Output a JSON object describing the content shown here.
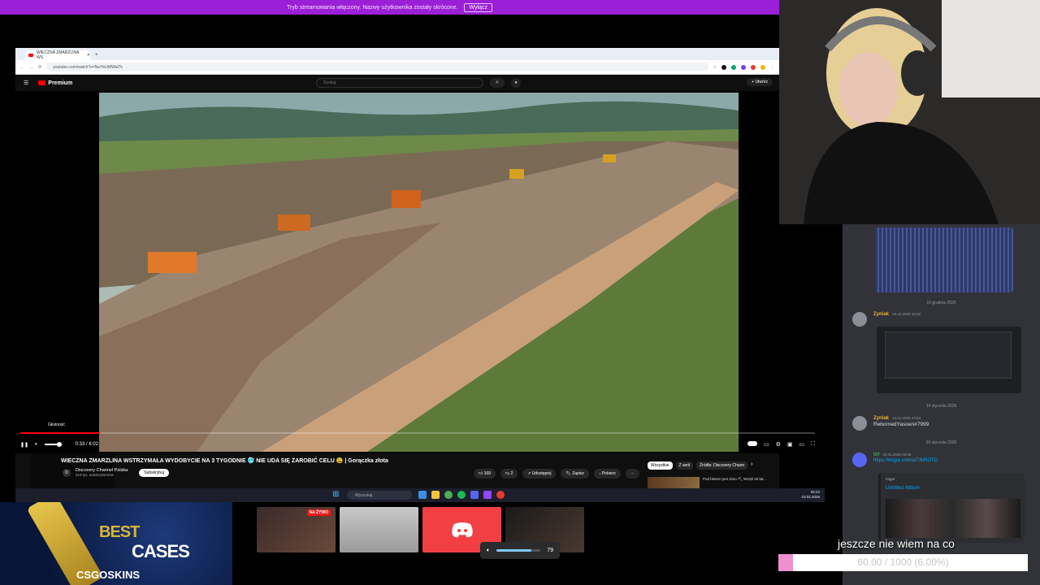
{
  "banner": {
    "message": "Tryb streamowania włączony. Nazwy użytkownika zostały skrócone.",
    "button": "Wyłącz"
  },
  "browser": {
    "tab_title": "WIECZNA ZMARZLINA WS",
    "new_tab": "+",
    "url": "youtube.com/watch?v=NwYeUMWal7k"
  },
  "youtube": {
    "logo": "Premium",
    "search_placeholder": "Szukaj",
    "create_label": "Utwórz",
    "volume_tooltip": "Głośność",
    "time": "0:33 / 6:02",
    "progress": 0.1,
    "title": "WIECZNA ZMARZLINA WSTRZYMAŁA WYDOBYCIE NA 3 TYGODNIE 🥶 NIE UDA SIĘ ZAROBIĆ CELU 😩 | Gorączka złota",
    "channel_name": "Discovery Channel Polska",
    "channel_subs": "519 tys. subskrybentów",
    "subscribe": "Subskrybuj",
    "likes": "169",
    "dislikes": "2",
    "share": "Udostępnij",
    "save": "Zapisz",
    "download": "Pobierz",
    "chips": [
      "Wszystkie",
      "Z serii",
      "Źródło: Discovery Chann"
    ],
    "recommended_title": "Pod błotem jest złoto ⛏ Wzięli 40 lat..."
  },
  "taskbar": {
    "search_placeholder": "Wyszukaj",
    "clock_time": "05:22",
    "clock_date": "10.02.2026"
  },
  "discord": {
    "date1": "16 grudnia 2025",
    "msg1_author": "Zyniak",
    "msg1_time": "16.12.2025 18:52",
    "date2": "14 stycznia 2026",
    "msg2_author": "Zyniak",
    "msg2_time": "14.01.2026 23:53",
    "msg2_text": "RebornedYasoen#7999",
    "date3": "20 stycznia 2026",
    "msg3_author": "tkf",
    "msg3_time": "20.01.2026 03:48",
    "msg3_link": "https://imgur.com/a/73kROTD",
    "embed_source": "Imgur",
    "embed_title": "Untitled Album"
  },
  "overlay": {
    "ad_best": "BEST",
    "ad_cases": "CASES",
    "ad_logo": "CSGOSKINS",
    "live_badge": "NA ŻYWO",
    "volume_value": "79",
    "volume_level": 0.79,
    "goal_text": "jeszcze nie wiem na co",
    "goal_value": "60.00 / 1000 (6.00%)",
    "goal_fraction": 0.06
  }
}
